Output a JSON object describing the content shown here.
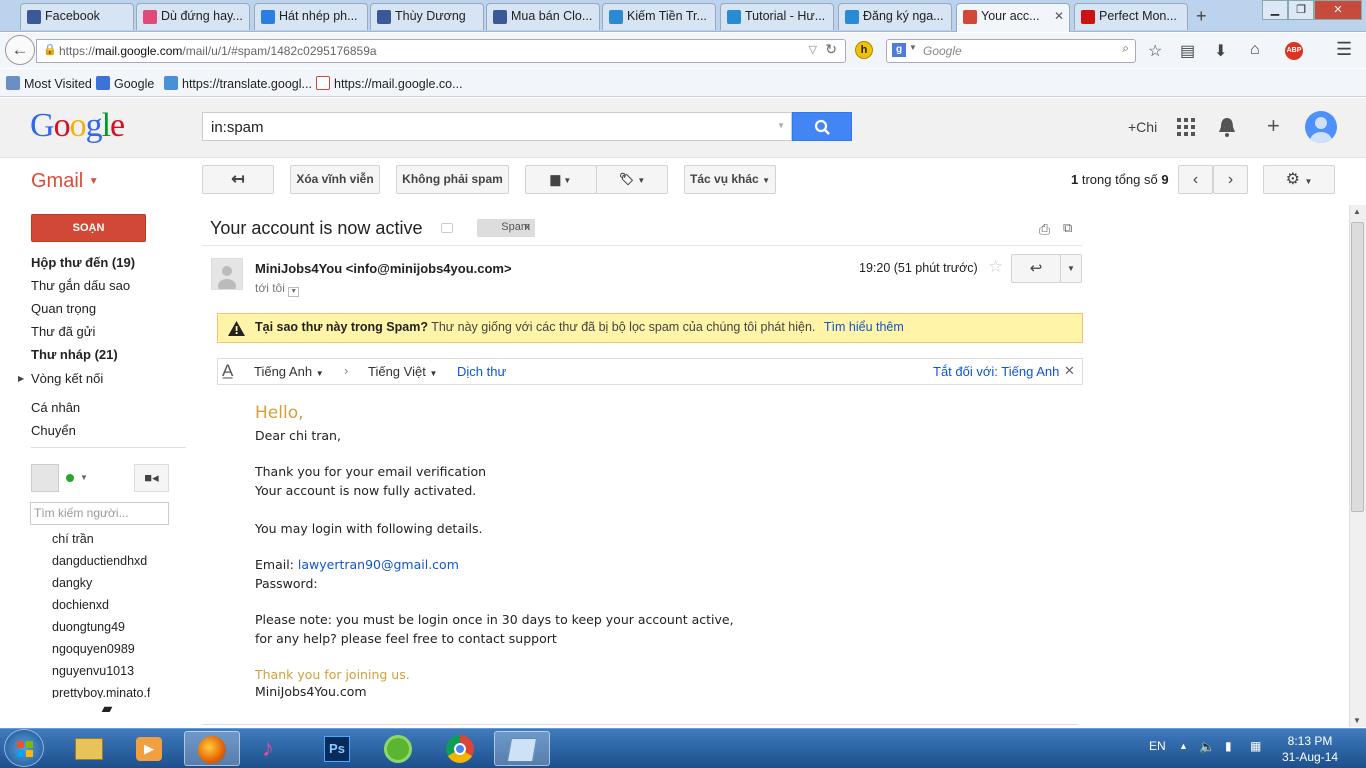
{
  "browser": {
    "tabs": [
      {
        "label": "Facebook",
        "icon": "facebook-icon",
        "color": "#3b5998"
      },
      {
        "label": "Dù đứng hay...",
        "icon": "face-icon",
        "color": "#e04a7a"
      },
      {
        "label": "Hát nhép ph...",
        "icon": "play-icon",
        "color": "#2a7de1"
      },
      {
        "label": "Thùy Dương",
        "icon": "facebook-icon",
        "color": "#3b5998"
      },
      {
        "label": "Mua bán Clo...",
        "icon": "facebook-icon",
        "color": "#3b5998"
      },
      {
        "label": "Kiếm Tiền Tr...",
        "icon": "globe-icon",
        "color": "#2a8ad4"
      },
      {
        "label": "Tutorial - Hư...",
        "icon": "globe-icon",
        "color": "#2a8ad4"
      },
      {
        "label": "Đăng ký nga...",
        "icon": "globe-icon",
        "color": "#2a8ad4"
      },
      {
        "label": "Your acc...",
        "icon": "gmail-icon",
        "color": "#d14836"
      },
      {
        "label": "Perfect Mon...",
        "icon": "pm-icon",
        "color": "#cc1111"
      }
    ],
    "url_prefix": "https://",
    "url_domain": "mail.google.com",
    "url_rest": "/mail/u/1/#spam/1482c0295176859a",
    "search_placeholder": "Google",
    "bookmarks": [
      "Most Visited",
      "Google",
      "https://translate.googl...",
      "https://mail.google.co..."
    ]
  },
  "gmail": {
    "search_value": "in:spam",
    "user_link": "+Chi",
    "app_label": "Gmail",
    "toolbar": {
      "delete_forever": "Xóa vĩnh viễn",
      "not_spam": "Không phải spam",
      "more": "Tác vụ khác",
      "page_count_bold": "1",
      "page_count_mid": " trong tổng số ",
      "page_count_total": "9"
    },
    "compose": "SOẠN",
    "nav": [
      {
        "label": "Hộp thư đến (19)",
        "bold": true
      },
      {
        "label": "Thư gắn dấu sao",
        "bold": false
      },
      {
        "label": "Quan trọng",
        "bold": false
      },
      {
        "label": "Thư đã gửi",
        "bold": false
      },
      {
        "label": "Thư nháp (21)",
        "bold": true
      },
      {
        "label": "Vòng kết nối",
        "bold": false
      },
      {
        "label": "Cá nhân",
        "bold": false
      },
      {
        "label": "Chuyển",
        "bold": false
      }
    ],
    "people_search_placeholder": "Tìm kiếm người...",
    "contacts": [
      "chí trần",
      "dangductiendhxd",
      "dangky",
      "dochienxd",
      "duongtung49",
      "ngoquyen0989",
      "nguyenvu1013",
      "prettyboy.minato.f"
    ]
  },
  "message": {
    "subject": "Your account is now active",
    "label": "Spam",
    "label_close": "x",
    "sender": "MiniJobs4You <info@minijobs4you.com>",
    "to": "tới tôi",
    "time": "19:20 (51 phút trước)",
    "spam_title": "Tại sao thư này trong Spam?",
    "spam_desc": "Thư này giống với các thư đã bị bộ lọc spam của chúng tôi phát hiện.",
    "spam_link": "Tìm hiểu thêm",
    "translate": {
      "from": "Tiếng Anh",
      "to": "Tiếng Việt",
      "action": "Dịch thư",
      "off": "Tắt đối với: Tiếng Anh"
    },
    "body": {
      "hello": "Hello,",
      "greeting": "Dear chi tran,",
      "line1": "Thank you for your email verification",
      "line2": "Your account is now fully activated.",
      "line3": "You may login with following details.",
      "email_label": "Email: ",
      "email_value": "lawyertran90@gmail.com",
      "password_label": "Password:",
      "note1": "Please note: you must be login once in 30 days to keep your account active,",
      "note2": "for any help? please feel free to  contact support",
      "thanks": "Thank you for joining us.",
      "signature": "MiniJobs4You.com"
    }
  },
  "taskbar": {
    "lang": "EN",
    "time": "8:13 PM",
    "date": "31-Aug-14"
  }
}
